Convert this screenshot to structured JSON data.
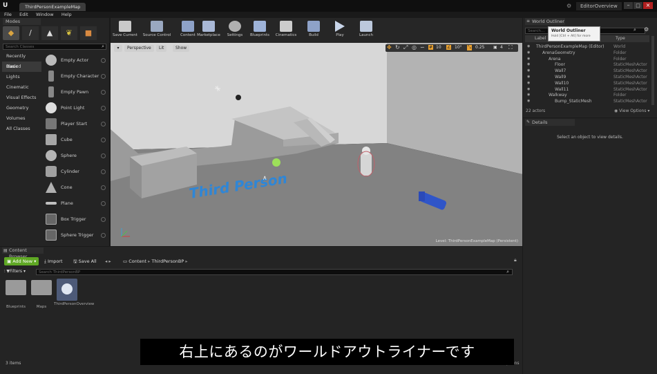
{
  "window": {
    "logo": "U",
    "tab": "ThirdPersonExampleMap",
    "project": "EditorOverview",
    "menu": [
      "File",
      "Edit",
      "Window",
      "Help"
    ]
  },
  "modes": {
    "tab": "Modes",
    "search_placeholder": "Search Classes",
    "categories": [
      "Recently Placed",
      "Basic",
      "Lights",
      "Cinematic",
      "Visual Effects",
      "Geometry",
      "Volumes",
      "All Classes"
    ],
    "selected_category": "Basic",
    "items": [
      "Empty Actor",
      "Empty Character",
      "Empty Pawn",
      "Point Light",
      "Player Start",
      "Cube",
      "Sphere",
      "Cylinder",
      "Cone",
      "Plane",
      "Box Trigger",
      "Sphere Trigger"
    ]
  },
  "toolbar": {
    "buttons": [
      "Save Current",
      "Source Control",
      "Content",
      "Marketplace",
      "Settings",
      "Blueprints",
      "Cinematics",
      "Build",
      "Play",
      "Launch"
    ]
  },
  "viewport": {
    "perspective": "Perspective",
    "lit": "Lit",
    "show": "Show",
    "grid_snap": "10",
    "rot_snap": "10°",
    "scale_snap": "0.25",
    "cam_speed": "4",
    "level_label": "Level:",
    "level_name": "ThirdPersonExampleMap (Persistent)",
    "floor_text": "Third Person"
  },
  "outliner": {
    "tab": "World Outliner",
    "search_placeholder": "Search...",
    "tooltip_title": "World Outliner",
    "tooltip_body": "Hold [Ctrl + Alt] for more",
    "col_label": "Label",
    "col_type": "Type",
    "rows": [
      {
        "label": "ThirdPersonExampleMap (Editor)",
        "type": "World",
        "indent": 0
      },
      {
        "label": "ArenaGeometry",
        "type": "Folder",
        "indent": 1
      },
      {
        "label": "Arena",
        "type": "Folder",
        "indent": 2
      },
      {
        "label": "Floor",
        "type": "StaticMeshActor",
        "indent": 3
      },
      {
        "label": "Wall7",
        "type": "StaticMeshActor",
        "indent": 3
      },
      {
        "label": "Wall9",
        "type": "StaticMeshActor",
        "indent": 3
      },
      {
        "label": "Wall10",
        "type": "StaticMeshActor",
        "indent": 3
      },
      {
        "label": "Wall11",
        "type": "StaticMeshActor",
        "indent": 3
      },
      {
        "label": "Walkway",
        "type": "Folder",
        "indent": 2
      },
      {
        "label": "Bump_StaticMesh",
        "type": "StaticMeshActor",
        "indent": 3
      }
    ],
    "count": "22 actors",
    "view_options": "View Options"
  },
  "details": {
    "tab": "Details",
    "empty": "Select an object to view details."
  },
  "content_browser": {
    "tab": "Content Browser",
    "add_new": "Add New",
    "import": "Import",
    "save_all": "Save All",
    "crumbs": [
      "Content",
      "ThirdPersonBP"
    ],
    "filters": "Filters",
    "search_placeholder": "Search ThirdPersonBP",
    "assets": [
      "Blueprints",
      "Maps",
      "ThirdPersonOverview"
    ],
    "count": "3 items",
    "view_options": "View Options"
  },
  "subtitle": "右上にあるのがワールドアウトライナーです",
  "colors": {
    "accent_green": "#5fa824",
    "outliner_header": "#2e2e2e",
    "floor_text": "#2f86d6"
  }
}
